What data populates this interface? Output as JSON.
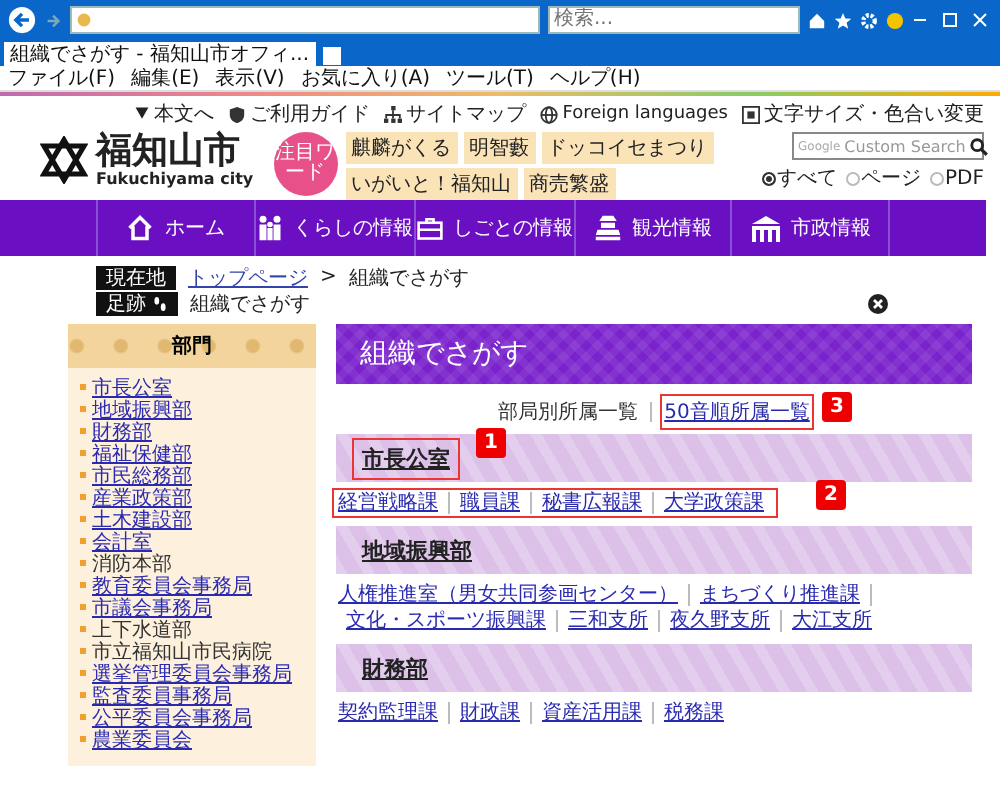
{
  "browser": {
    "search_placeholder": "検索...",
    "tab_title": "組織でさがす - 福知山市オフィ...",
    "menu": [
      "ファイル(F)",
      "編集(E)",
      "表示(V)",
      "お気に入り(A)",
      "ツール(T)",
      "ヘルプ(H)"
    ]
  },
  "header": {
    "logo_title": "福知山市",
    "logo_subtitle": "Fukuchiyama city",
    "links": [
      {
        "kind": "down",
        "text": "本文へ"
      },
      {
        "kind": "guide",
        "text": "ご利用ガイド"
      },
      {
        "kind": "sitemap",
        "text": "サイトマップ"
      },
      {
        "kind": "globe",
        "text": "Foreign languages"
      },
      {
        "kind": "textsize",
        "text": "文字サイズ・色合い変更"
      }
    ],
    "keyword_badge": "注目ワード",
    "keywords": [
      "麒麟がくる",
      "明智藪",
      "ドッコイセまつり",
      "いがいと！福知山",
      "商売繁盛"
    ],
    "search_brand": "Google",
    "search_placeholder": "Custom Search",
    "scopes": [
      {
        "label": "すべて",
        "selected": true
      },
      {
        "label": "ページ",
        "selected": false
      },
      {
        "label": "PDF",
        "selected": false
      }
    ]
  },
  "nav": [
    {
      "kind": "home",
      "label": "ホーム"
    },
    {
      "kind": "people",
      "label": "くらしの情報"
    },
    {
      "kind": "work",
      "label": "しごとの情報"
    },
    {
      "kind": "sight",
      "label": "観光情報"
    },
    {
      "kind": "city",
      "label": "市政情報"
    }
  ],
  "breadcrumb": {
    "label": "現在地",
    "separator": ">",
    "items": [
      {
        "text": "トップページ",
        "link": true
      },
      {
        "text": "組織でさがす",
        "link": false
      }
    ]
  },
  "footprints": {
    "label": "足跡",
    "items": [
      "組織でさがす"
    ]
  },
  "sidebar": {
    "heading": "部門",
    "items": [
      {
        "text": "市長公室",
        "link": true
      },
      {
        "text": "地域振興部",
        "link": true
      },
      {
        "text": "財務部",
        "link": true
      },
      {
        "text": "福祉保健部",
        "link": true
      },
      {
        "text": "市民総務部",
        "link": true
      },
      {
        "text": "産業政策部",
        "link": true
      },
      {
        "text": "土木建設部",
        "link": true
      },
      {
        "text": "会計室",
        "link": true
      },
      {
        "text": "消防本部",
        "link": false
      },
      {
        "text": "教育委員会事務局",
        "link": true
      },
      {
        "text": "市議会事務局",
        "link": true
      },
      {
        "text": "上下水道部",
        "link": false
      },
      {
        "text": "市立福知山市民病院",
        "link": false
      },
      {
        "text": "選挙管理委員会事務局",
        "link": true
      },
      {
        "text": "監査委員事務局",
        "link": true
      },
      {
        "text": "公平委員会事務局",
        "link": true
      },
      {
        "text": "農業委員会",
        "link": true
      }
    ]
  },
  "main": {
    "title": "組織でさがす",
    "views": [
      {
        "label": "部局別所属一覧",
        "selected": true
      },
      {
        "label": "50音順所属一覧",
        "selected": false,
        "callout": "3"
      }
    ],
    "sections": [
      {
        "name": "市長公室",
        "callout": "1",
        "links_callout": "2",
        "links": [
          "経営戦略課",
          "職員課",
          "秘書広報課",
          "大学政策課"
        ]
      },
      {
        "name": "地域振興部",
        "links": [
          "人権推進室（男女共同参画センター）",
          "まちづくり推進課",
          "文化・スポーツ振興課",
          "三和支所",
          "夜久野支所",
          "大江支所"
        ]
      },
      {
        "name": "財務部",
        "links": [
          "契約監理課",
          "財政課",
          "資産活用課",
          "税務課"
        ]
      }
    ]
  }
}
